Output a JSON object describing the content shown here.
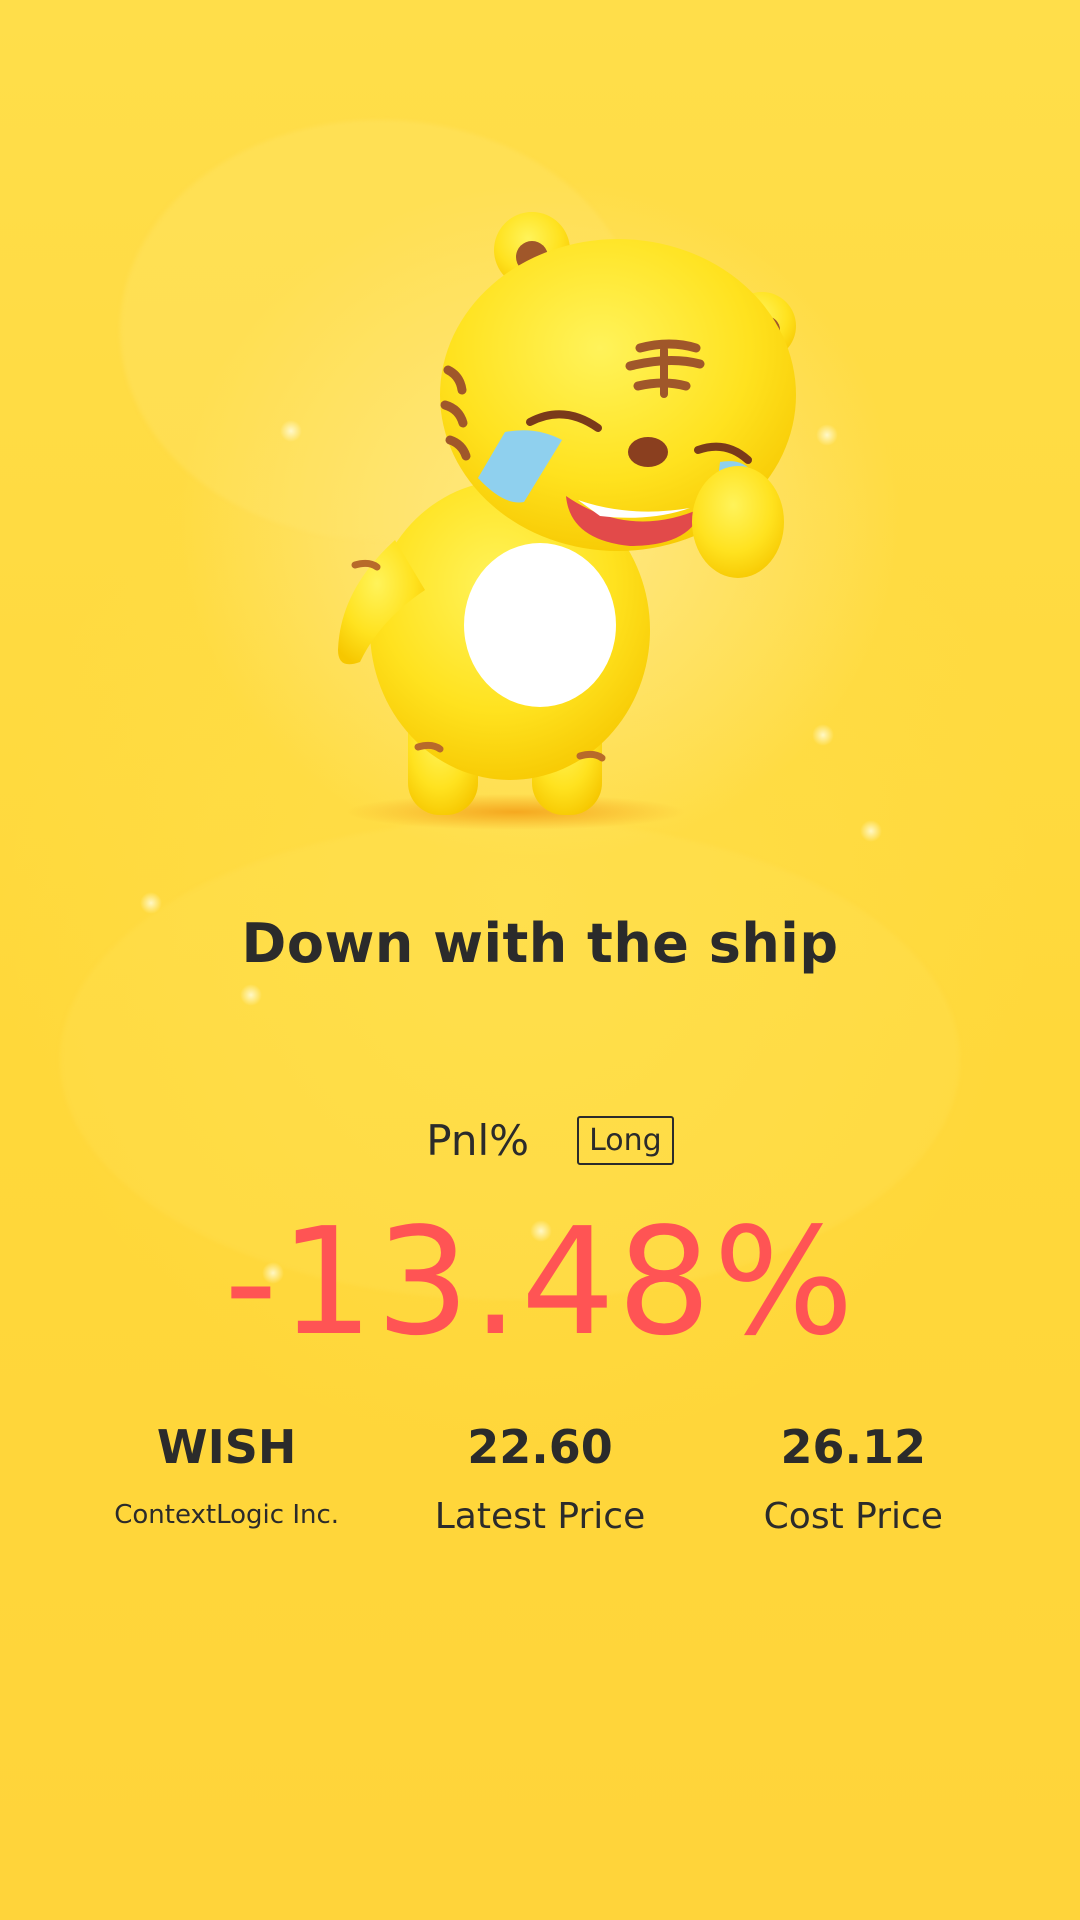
{
  "header": {
    "title": "Down with the ship"
  },
  "pnl": {
    "label": "Pnl%",
    "direction": "Long",
    "value": "-13.48%",
    "value_color": "#ff5454"
  },
  "stats": {
    "symbol": "WISH",
    "company": "ContextLogic Inc.",
    "latest_price": "22.60",
    "latest_price_label": "Latest Price",
    "cost_price": "26.12",
    "cost_price_label": "Cost Price"
  },
  "mascot": {
    "icon": "crying-tiger-mascot-icon"
  },
  "colors": {
    "background": "#ffd83a",
    "text": "#2b2b2b",
    "loss": "#ff5454"
  }
}
